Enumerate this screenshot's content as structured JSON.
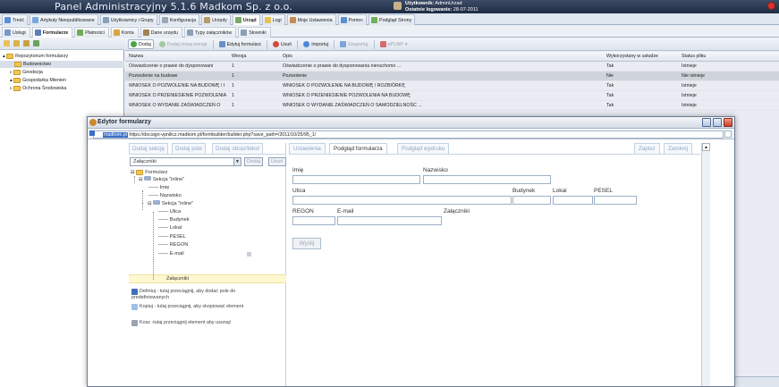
{
  "app": {
    "title": "Panel Administracyjny 5.1.6 Madkom Sp. z o.o.",
    "user_label": "Użytkownik:",
    "user_name": "AdminUrzad",
    "last_login_label": "Ostatnie logowanie:",
    "last_login_date": "28-07-2011"
  },
  "main_tabs": [
    {
      "label": "Treść",
      "icon": "content-icon",
      "color": "#5a8fd6"
    },
    {
      "label": "Artykuły Nieopublikowane",
      "icon": "articles-icon",
      "color": "#7aa7de"
    },
    {
      "label": "Użytkownicy i Grupy",
      "icon": "users-icon",
      "color": "#8aa0b8"
    },
    {
      "label": "Konfiguracja",
      "icon": "config-icon",
      "color": "#9aa8b6"
    },
    {
      "label": "Urzędy",
      "icon": "office-icon",
      "color": "#b39b6a"
    },
    {
      "label": "Urząd",
      "icon": "office-icon",
      "color": "#79a86a"
    },
    {
      "label": "Logi",
      "icon": "logs-icon",
      "color": "#e2c25a"
    },
    {
      "label": "Moje Ustawienia",
      "icon": "settings-icon",
      "color": "#c98a52"
    },
    {
      "label": "Pomoc",
      "icon": "help-icon",
      "color": "#5c8fd1"
    },
    {
      "label": "Podgląd Strony",
      "icon": "preview-icon",
      "color": "#6fb05a"
    }
  ],
  "sub_tabs": [
    {
      "label": "Usługi",
      "icon": "services-icon",
      "color": "#7899c4"
    },
    {
      "label": "Formularze",
      "icon": "forms-icon",
      "color": "#5d7fb8"
    },
    {
      "label": "Płatności",
      "icon": "payments-icon",
      "color": "#6fae58"
    },
    {
      "label": "Konta",
      "icon": "accounts-icon",
      "color": "#d9a740"
    },
    {
      "label": "Dane urzędu",
      "icon": "office-data-icon",
      "color": "#a08456"
    },
    {
      "label": "Typy załączników",
      "icon": "attachment-types-icon",
      "color": "#8aa0b8"
    },
    {
      "label": "Słowniki",
      "icon": "dictionary-icon",
      "color": "#8aa0b8"
    }
  ],
  "tree": {
    "root": "Repozytorium formularzy",
    "items": [
      "Budownictwo",
      "Geodezja",
      "Gospodarka Mienien",
      "Ochrona Środowiska"
    ]
  },
  "grid_toolbar": {
    "add": "Dodaj",
    "add_version": "Dodaj nową wersję",
    "edit": "Edytuj formularz",
    "delete": "Usuń",
    "import": "Importuj",
    "export": "Eksportuj",
    "epuap": "ePUAP"
  },
  "grid": {
    "columns": [
      "Nazwa",
      "Wersja",
      "Opis",
      "Wykorzystany w usłudze",
      "Status pliku"
    ],
    "rows": [
      [
        "Oświadczenie o prawie do dysponowani",
        "1",
        "Oświadczenie o prawie do dysponowania nieruchomo ...",
        "Tak",
        "Istnieje"
      ],
      [
        "Pozwolenie na budowe",
        "1",
        "Pozwolenie",
        "Nie",
        "Nie istnieje"
      ],
      [
        "WNIOSEK O POZWOLENIE NA BUDOWĘ / I",
        "1",
        "WNIOSEK O POZWOLENIE NA BUDOWĘ / ROZBIÓRKĘ",
        "Tak",
        "Istnieje"
      ],
      [
        "WNIOSEK O PRZENIESIENIE POZWOLENIA",
        "1",
        "WNIOSEK O PRZENIESIENIE POZWOLENIA NA BUDOWĘ",
        "Tak",
        "Istnieje"
      ],
      [
        "WNIOSEK O WYDANIE ZAŚWIADCZEŃ O",
        "1",
        "WNIOSEK O WYDANIE ZAŚWIADCZEŃ O SAMODZIELNOŚC ...",
        "Tak",
        "Istnieje"
      ]
    ]
  },
  "dialog": {
    "title": "Edytor formularzy",
    "url_host": "madkom.pl",
    "url": "https://docsign-vpnilicz.madkom.pl/formbuilder/builder.php?save_path=/2011/10/25/95_1/",
    "left_tabs": [
      "Dodaj sekcję",
      "Dodaj pole",
      "Dodaj obraz/tekst"
    ],
    "combo_value": "Załączniki",
    "add_btn": "Dodaj",
    "remove_btn": "Usuń",
    "form_tree": {
      "root": "Formularz",
      "section1": "Sekcja \"inline\"",
      "section1_fields": [
        "Imię",
        "Nazwisko"
      ],
      "section2": "Sekcja \"inline\"",
      "section2_fields": [
        "Ulica",
        "Budynek",
        "Lokal",
        "PESEL",
        "REGON",
        "E-mail"
      ],
      "selected": "Załączniki"
    },
    "legend": [
      {
        "text": "Definiuj - tutaj przeciągnij, aby dodać pole do predefiniowanych",
        "icon": "save-icon"
      },
      {
        "text": "Kopiuj - tutaj przeciągnij, aby skopiować element",
        "icon": "copy-icon"
      },
      {
        "text": "Kosz -tutaj przeciągnij element aby usunąć",
        "icon": "trash-icon"
      }
    ],
    "right_tabs": [
      "Ustawienia",
      "Podgląd formularza",
      "Podgląd wydruku"
    ],
    "save_btn": "Zapisz",
    "close_btn": "Zamknij",
    "fields": {
      "imie": "Imię",
      "nazwisko": "Nazwisko",
      "ulica": "Ulica",
      "budynek": "Budynek",
      "lokal": "Lokal",
      "pesel": "PESEL",
      "regon": "REGON",
      "email": "E-mail",
      "zalaczniki": "Załączniki"
    },
    "send_btn": "Wyślij"
  }
}
